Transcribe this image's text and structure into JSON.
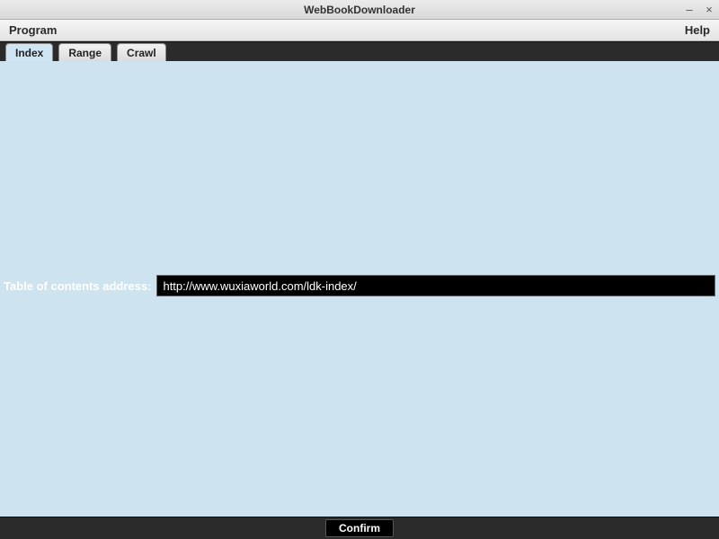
{
  "window": {
    "title": "WebBookDownloader"
  },
  "menubar": {
    "program": "Program",
    "help": "Help"
  },
  "tabs": {
    "index": "Index",
    "range": "Range",
    "crawl": "Crawl"
  },
  "form": {
    "label": "Table of contents address:",
    "value": "http://www.wuxiaworld.com/ldk-index/"
  },
  "footer": {
    "confirm": "Confirm"
  }
}
